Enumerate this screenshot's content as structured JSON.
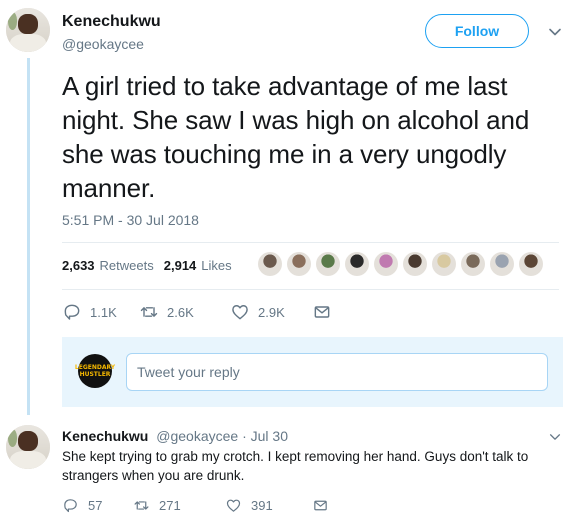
{
  "tweet": {
    "author_name": "Kenechukwu",
    "author_handle": "@geokaycee",
    "follow_label": "Follow",
    "text": "A girl tried to take advantage of me last night. She saw I was high on alcohol and she was touching me in a very ungodly manner.",
    "timestamp": "5:51 PM - 30 Jul 2018",
    "retweets_count": "2,633",
    "retweets_label": "Retweets",
    "likes_count": "2,914",
    "likes_label": "Likes",
    "liker_colors": [
      "#6b5a4e",
      "#8a6f5c",
      "#5a7a4a",
      "#2a2a2a",
      "#c07ab0",
      "#4a3a30",
      "#d8c9a0",
      "#7a6a5a",
      "#9aa3b0",
      "#5c4636"
    ],
    "actions": {
      "replies": "1.1K",
      "retweets": "2.6K",
      "likes": "2.9K"
    }
  },
  "reply_box": {
    "avatar_text": "LEGENDARY HUSTLER",
    "placeholder": "Tweet your reply"
  },
  "reply": {
    "author_name": "Kenechukwu",
    "author_handle": "@geokaycee",
    "date": "· Jul 30",
    "text": "She kept trying to grab my crotch. I kept removing her hand. Guys don't talk to strangers when you are drunk.",
    "actions": {
      "replies": "57",
      "retweets": "271",
      "likes": "391"
    }
  },
  "colors": {
    "accent": "#1da1f2",
    "muted": "#657786",
    "text": "#14171a",
    "thread_line": "#c4e2f4",
    "reply_box_bg": "#e8f5fd"
  }
}
